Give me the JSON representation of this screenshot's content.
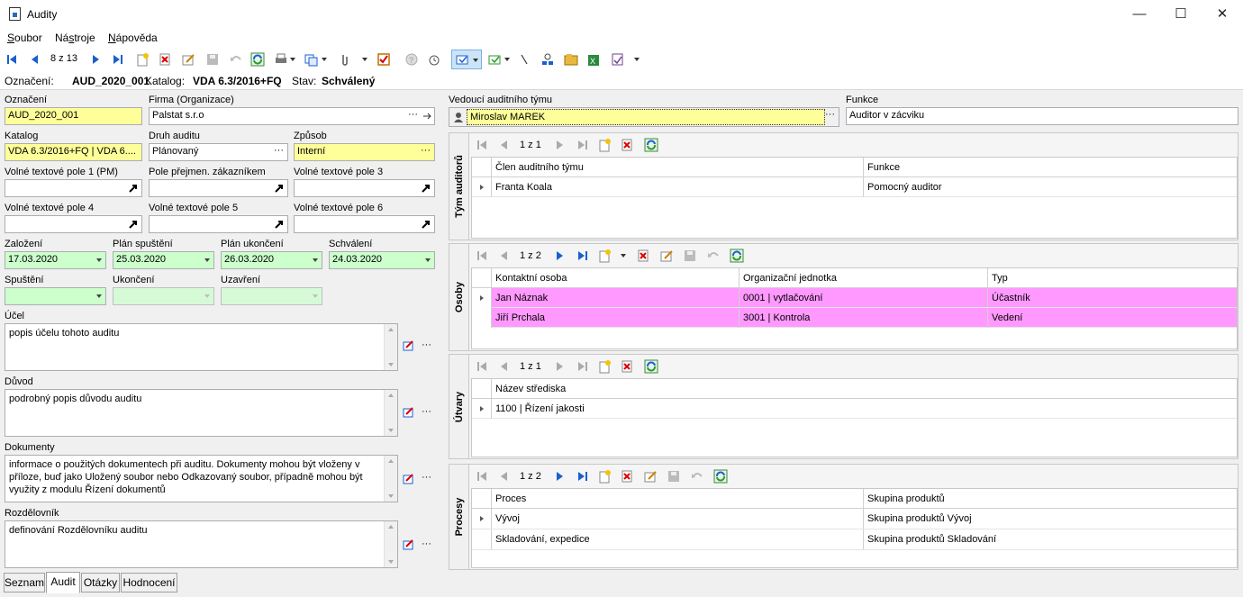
{
  "window": {
    "title": "Audity"
  },
  "menu": [
    "Soubor",
    "Nástroje",
    "Nápověda"
  ],
  "menu_underline": [
    "S",
    "s",
    "N"
  ],
  "toolbar": {
    "record_counter": "8 z 13"
  },
  "info": {
    "oznaceni_label": "Označení:",
    "oznaceni_value": "AUD_2020_001",
    "katalog_label": "Katalog:",
    "katalog_value": "VDA 6.3/2016+FQ",
    "stav_label": "Stav:",
    "stav_value": "Schválený"
  },
  "form": {
    "oznaceni": {
      "label": "Označení",
      "value": "AUD_2020_001"
    },
    "firma": {
      "label": "Firma (Organizace)",
      "value": "Palstat s.r.o"
    },
    "katalog": {
      "label": "Katalog",
      "value": "VDA 6.3/2016+FQ | VDA 6...."
    },
    "druh": {
      "label": "Druh auditu",
      "value": "Plánovaný"
    },
    "zpusob": {
      "label": "Způsob",
      "value": "Interní"
    },
    "vtp1": {
      "label": "Volné textové pole 1 (PM)",
      "value": ""
    },
    "pole_prejmen": {
      "label": "Pole přejmen. zákazníkem",
      "value": ""
    },
    "vtp3": {
      "label": "Volné textové pole 3",
      "value": ""
    },
    "vtp4": {
      "label": "Volné textové pole 4",
      "value": ""
    },
    "vtp5": {
      "label": "Volné textové pole 5",
      "value": ""
    },
    "vtp6": {
      "label": "Volné textové pole 6",
      "value": ""
    },
    "zalozeni": {
      "label": "Založení",
      "value": "17.03.2020"
    },
    "plan_spusteni": {
      "label": "Plán spuštění",
      "value": "25.03.2020"
    },
    "plan_ukonceni": {
      "label": "Plán ukončení",
      "value": "26.03.2020"
    },
    "schvaleni": {
      "label": "Schválení",
      "value": "24.03.2020"
    },
    "spusteni": {
      "label": "Spuštění",
      "value": ""
    },
    "ukonceni": {
      "label": "Ukončení",
      "value": ""
    },
    "uzavreni": {
      "label": "Uzavření",
      "value": ""
    },
    "ucel": {
      "label": "Účel",
      "value": "popis účelu tohoto auditu"
    },
    "duvod": {
      "label": "Důvod",
      "value": "podrobný popis důvodu auditu"
    },
    "dokumenty": {
      "label": "Dokumenty",
      "value": "informace o použitých dokumentech při auditu. Dokumenty mohou být vloženy v příloze, buď jako Uložený soubor nebo Odkazovaný soubor, případně mohou být využity z modulu Řízení dokumentů"
    },
    "rozdelovnik": {
      "label": "Rozdělovník",
      "value": "definování Rozdělovníku auditu"
    },
    "vedouci": {
      "label": "Vedoucí auditního týmu",
      "value": "Miroslav MAREK"
    },
    "funkce": {
      "label": "Funkce",
      "value": "Auditor v zácviku"
    },
    "ellipsis": "···"
  },
  "panels": {
    "tym": {
      "title": "Tým auditorů",
      "counter": "1 z 1",
      "columns": [
        "Člen auditního týmu",
        "Funkce"
      ],
      "rows": [
        [
          "Franta Koala",
          "Pomocný auditor"
        ]
      ]
    },
    "osoby": {
      "title": "Osoby",
      "counter": "1 z 2",
      "columns": [
        "Kontaktní osoba",
        "Organizační jednotka",
        "Typ"
      ],
      "rows": [
        [
          "Jan Náznak",
          "0001 | vytlačování",
          "Účastník"
        ],
        [
          "Jiří Prchala",
          "3001 | Kontrola",
          "Vedení"
        ]
      ]
    },
    "utvary": {
      "title": "Útvary",
      "counter": "1 z 1",
      "columns": [
        "Název střediska"
      ],
      "rows": [
        [
          "1100 | Řízení jakosti"
        ]
      ]
    },
    "procesy": {
      "title": "Procesy",
      "counter": "1 z 2",
      "columns": [
        "Proces",
        "Skupina produktů"
      ],
      "rows": [
        [
          "Vývoj",
          "Skupina produktů Vývoj"
        ],
        [
          "Skladování, expedice",
          "Skupina produktů Skladování"
        ]
      ]
    }
  },
  "tabs": [
    "Seznam",
    "Audit",
    "Otázky",
    "Hodnocení"
  ],
  "colors": {
    "yellow_field": "#ffff99",
    "green_field": "#ccffcc",
    "pink_row": "#ff99ff",
    "nav_blue": "#1a5fd0"
  }
}
